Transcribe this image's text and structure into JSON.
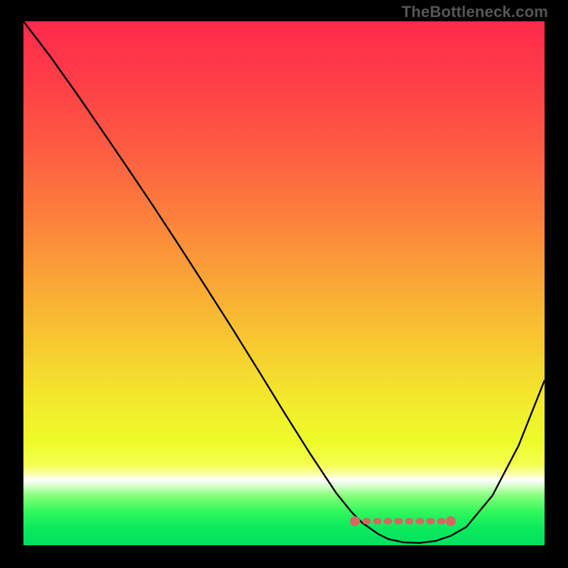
{
  "watermark": "TheBottleneck.com",
  "chart_data": {
    "type": "line",
    "title": "",
    "xlabel": "",
    "ylabel": "",
    "xlim": [
      0,
      100
    ],
    "ylim": [
      0,
      100
    ],
    "grid": false,
    "legend": false,
    "series": [
      {
        "name": "bottleneck-curve",
        "x": [
          0,
          5,
          10,
          15,
          20,
          25,
          30,
          35,
          40,
          45,
          50,
          55,
          60,
          63,
          65,
          68,
          70,
          73,
          76,
          79,
          82,
          85,
          90,
          95,
          100
        ],
        "y": [
          100,
          93.5,
          86.5,
          79.3,
          72.0,
          64.6,
          57.0,
          49.3,
          41.5,
          33.5,
          25.4,
          17.5,
          10.0,
          6.3,
          4.3,
          2.2,
          1.2,
          0.55,
          0.45,
          0.8,
          1.8,
          3.5,
          9.5,
          19.0,
          31.5
        ]
      }
    ],
    "annotations": [
      {
        "name": "flat-bottom-marker",
        "type": "segment",
        "x0": 63.6,
        "y0": 4.6,
        "x1": 82.0,
        "y1": 4.6,
        "style": "thick-dashed",
        "color": "#D16A61"
      }
    ],
    "background": {
      "type": "vertical-gradient",
      "stops": [
        {
          "offset": 0.0,
          "color": "#FE2A4B"
        },
        {
          "offset": 0.12,
          "color": "#FE3F47"
        },
        {
          "offset": 0.25,
          "color": "#FD5E41"
        },
        {
          "offset": 0.38,
          "color": "#FC823C"
        },
        {
          "offset": 0.5,
          "color": "#FAA736"
        },
        {
          "offset": 0.62,
          "color": "#F7CB30"
        },
        {
          "offset": 0.72,
          "color": "#F3E82C"
        },
        {
          "offset": 0.8,
          "color": "#EDFB2A"
        },
        {
          "offset": 0.845,
          "color": "#F3FF4D"
        },
        {
          "offset": 0.865,
          "color": "#FBFFB0"
        },
        {
          "offset": 0.875,
          "color": "#FFFFFF"
        },
        {
          "offset": 0.887,
          "color": "#D6FFCB"
        },
        {
          "offset": 0.905,
          "color": "#87FF7B"
        },
        {
          "offset": 0.935,
          "color": "#33F85B"
        },
        {
          "offset": 0.965,
          "color": "#0CEB5E"
        },
        {
          "offset": 1.0,
          "color": "#03DF60"
        }
      ]
    }
  }
}
